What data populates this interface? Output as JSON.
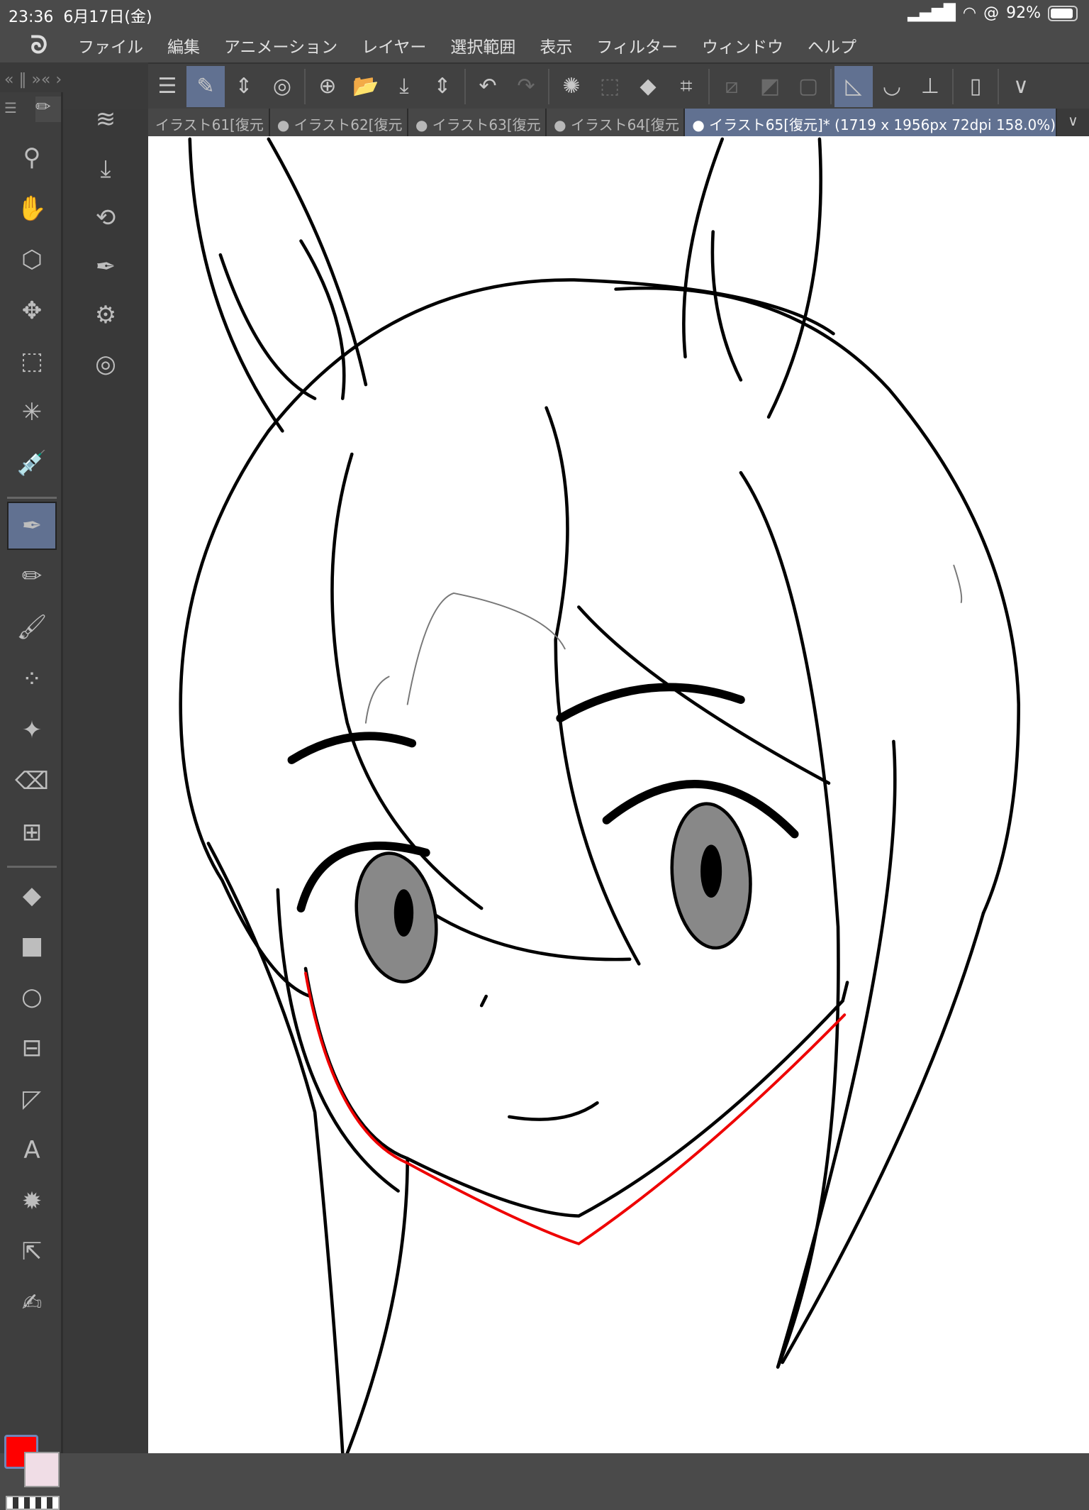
{
  "status": {
    "time": "23:36",
    "date": "6月17日(金)",
    "battery": "92%",
    "icons": [
      "signal-icon",
      "wifi-icon",
      "orientation-lock-icon",
      "battery-icon"
    ]
  },
  "menu": {
    "logo": "ᘐ",
    "items": [
      "ファイル",
      "編集",
      "アニメーション",
      "レイヤー",
      "選択範囲",
      "表示",
      "フィルター",
      "ウィンドウ",
      "ヘルプ"
    ]
  },
  "panel_header": "«  ‖ »«  ›",
  "toolbar": [
    {
      "icon": "menu-icon",
      "glyph": "☰"
    },
    {
      "icon": "brush-selected-icon",
      "glyph": "✎",
      "sel": true
    },
    {
      "icon": "up-down-icon",
      "glyph": "⇕"
    },
    {
      "icon": "spiral-icon",
      "glyph": "◎"
    },
    {
      "sep": true
    },
    {
      "icon": "new-canvas-icon",
      "glyph": "⊕"
    },
    {
      "icon": "open-icon",
      "glyph": "📂"
    },
    {
      "icon": "save-icon",
      "glyph": "⤓"
    },
    {
      "icon": "up-down-icon",
      "glyph": "⇕"
    },
    {
      "sep": true
    },
    {
      "icon": "undo-icon",
      "glyph": "↶"
    },
    {
      "icon": "redo-icon",
      "glyph": "↷",
      "dim": true
    },
    {
      "sep": true
    },
    {
      "icon": "loading-icon",
      "glyph": "✺"
    },
    {
      "icon": "select-dim-icon",
      "glyph": "⬚",
      "dim": true
    },
    {
      "icon": "fill-icon",
      "glyph": "◆"
    },
    {
      "icon": "transform-icon",
      "glyph": "⌗"
    },
    {
      "sep": true
    },
    {
      "icon": "clear-selection-icon",
      "glyph": "⧄",
      "dim": true
    },
    {
      "icon": "invert-icon",
      "glyph": "◩",
      "dim": true
    },
    {
      "icon": "selection-border-icon",
      "glyph": "▢",
      "dim": true
    },
    {
      "sep": true
    },
    {
      "icon": "ruler-snap-icon",
      "glyph": "◺",
      "sel": true
    },
    {
      "icon": "ruler-bowl-icon",
      "glyph": "◡"
    },
    {
      "icon": "ruler-line-icon",
      "glyph": "⊥"
    },
    {
      "sep": true
    },
    {
      "icon": "device-icon",
      "glyph": "▯"
    },
    {
      "sep": true
    },
    {
      "icon": "chevron-down-icon",
      "glyph": "∨"
    }
  ],
  "tabs": [
    {
      "label": "イラスト61[復元"
    },
    {
      "label": "● イラスト62[復元"
    },
    {
      "label": "● イラスト63[復元"
    },
    {
      "label": "● イラスト64[復元"
    },
    {
      "label": "● イラスト65[復元]* (1719 x 1956px 72dpi 158.0%)",
      "active": true
    }
  ],
  "tabs_more": "∨",
  "tools": [
    {
      "name": "zoom",
      "glyph": "⚲"
    },
    {
      "name": "hand",
      "glyph": "✋"
    },
    {
      "name": "object",
      "glyph": "⬡"
    },
    {
      "name": "move",
      "glyph": "✥"
    },
    {
      "name": "selection",
      "glyph": "⬚"
    },
    {
      "name": "auto-select",
      "glyph": "✳"
    },
    {
      "name": "eyedropper",
      "glyph": "💉"
    },
    {
      "name": "pen",
      "glyph": "✒",
      "sel": true
    },
    {
      "name": "pencil",
      "glyph": "✏"
    },
    {
      "name": "brush",
      "glyph": "🖌"
    },
    {
      "name": "airbrush",
      "glyph": "⁘"
    },
    {
      "name": "decoration",
      "glyph": "✦"
    },
    {
      "name": "eraser",
      "glyph": "⌫"
    },
    {
      "name": "blend",
      "glyph": "⊞"
    },
    {
      "name": "fill",
      "glyph": "◆"
    },
    {
      "name": "gradient",
      "glyph": "■"
    },
    {
      "name": "figure",
      "glyph": "○"
    },
    {
      "name": "frame",
      "glyph": "⊟"
    },
    {
      "name": "ruler",
      "glyph": "◸"
    },
    {
      "name": "text",
      "glyph": "A"
    },
    {
      "name": "balloon",
      "glyph": "✹"
    },
    {
      "name": "correct-line",
      "glyph": "⇱"
    },
    {
      "name": "lasso-fill",
      "glyph": "✍"
    }
  ],
  "subtools": [
    {
      "name": "layer",
      "glyph": "≋"
    },
    {
      "name": "import",
      "glyph": "⤓"
    },
    {
      "name": "navigator",
      "glyph": "⟲"
    },
    {
      "name": "sub-tool-detail",
      "glyph": "✒"
    },
    {
      "name": "tool-property",
      "glyph": "⚙"
    },
    {
      "name": "brush-size",
      "glyph": "◎"
    }
  ],
  "colors": {
    "main": "#ff0000",
    "sub": "#f0dde6",
    "accent": "#617191"
  }
}
